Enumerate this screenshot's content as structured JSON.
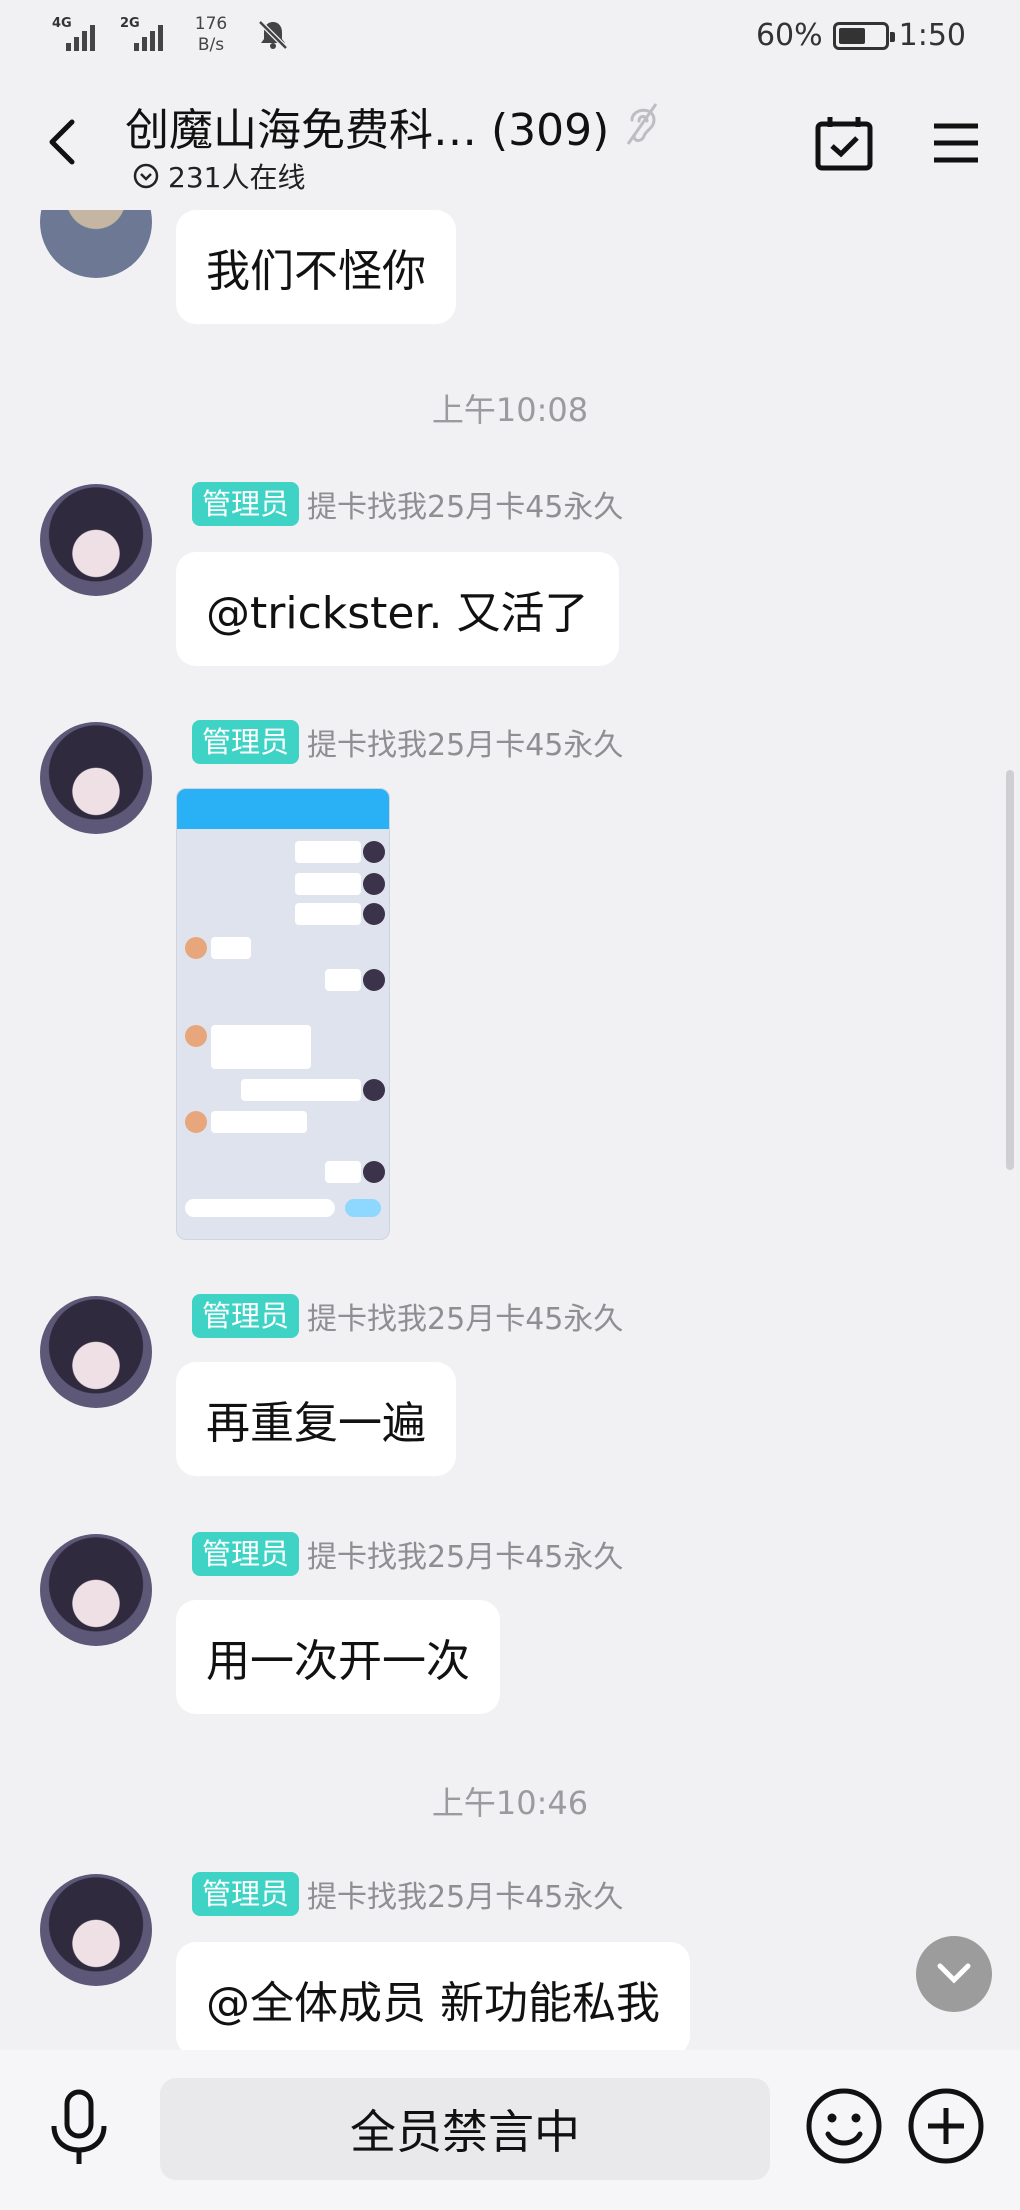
{
  "status_bar": {
    "network1": "4G",
    "network2": "2G",
    "speed_value": "176",
    "speed_unit": "B/s",
    "battery_percent": "60%",
    "battery_level": 0.6,
    "time": "1:50"
  },
  "header": {
    "title": "创魔山海免费科… (309)",
    "online": "231人在线"
  },
  "messages": {
    "m0_text": "我们不怪你",
    "time1": "上午10:08",
    "badge": "管理员",
    "sender": "提卡找我25月卡45永久",
    "m1_text": "@trickster. 又活了",
    "m3_text": "再重复一遍",
    "m4_text": "用一次开一次",
    "time2": "上午10:46",
    "m5_text": "@全体成员 新功能私我"
  },
  "bottom": {
    "muted_label": "全员禁言中"
  },
  "colors": {
    "background": "#f1f1f3",
    "badge": "#3fd3c6",
    "bubble": "#ffffff"
  }
}
